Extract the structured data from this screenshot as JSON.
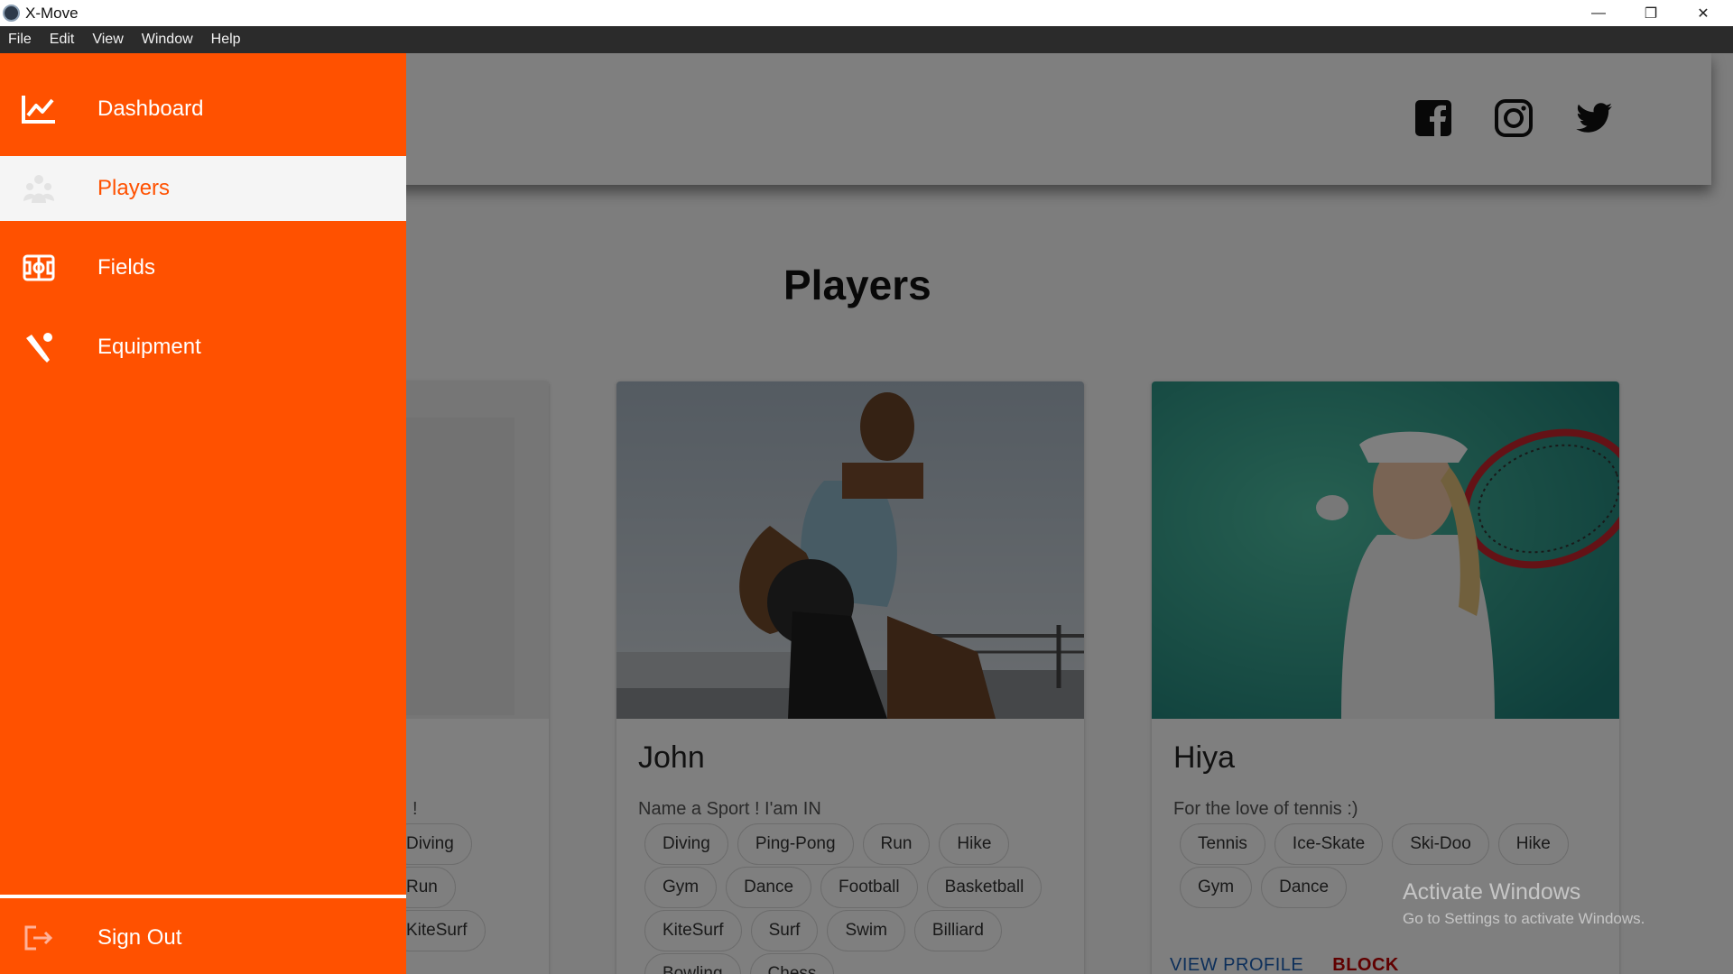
{
  "window": {
    "title": "X-Move",
    "minimize_glyph": "—",
    "maximize_glyph": "❐",
    "close_glyph": "✕"
  },
  "menubar": {
    "items": [
      "File",
      "Edit",
      "View",
      "Window",
      "Help"
    ]
  },
  "sidebar": {
    "items": [
      {
        "label": "Dashboard",
        "icon": "chart-line-icon",
        "active": false
      },
      {
        "label": "Players",
        "icon": "players-icon",
        "active": true
      },
      {
        "label": "Fields",
        "icon": "field-icon",
        "active": false
      },
      {
        "label": "Equipment",
        "icon": "equipment-icon",
        "active": false
      }
    ],
    "signout": {
      "label": "Sign Out",
      "icon": "sign-out-icon"
    }
  },
  "header": {
    "social": [
      "facebook-icon",
      "instagram-icon",
      "twitter-icon"
    ]
  },
  "main": {
    "title": "Players",
    "cards": [
      {
        "name": "",
        "bio": "!",
        "tags": [
          "Diving",
          "Run",
          "KiteSurf"
        ]
      },
      {
        "name": "John",
        "bio": "Name a Sport ! I'am IN",
        "tags": [
          "Diving",
          "Ping-Pong",
          "Run",
          "Hike",
          "Gym",
          "Dance",
          "Football",
          "Basketball",
          "KiteSurf",
          "Surf",
          "Swim",
          "Billiard",
          "Bowling",
          "Chess"
        ]
      },
      {
        "name": "Hiya",
        "bio": "For the love of tennis :)",
        "tags": [
          "Tennis",
          "Ice-Skate",
          "Ski-Doo",
          "Hike",
          "Gym",
          "Dance"
        ],
        "view_label": "VIEW PROFILE",
        "block_label": "BLOCK"
      }
    ]
  },
  "watermark": {
    "title": "Activate Windows",
    "subtitle": "Go to Settings to activate Windows."
  },
  "colors": {
    "accent": "#ff5100",
    "menubar": "#2b2b2b",
    "link": "#1a5fb4",
    "danger": "#c00000"
  }
}
